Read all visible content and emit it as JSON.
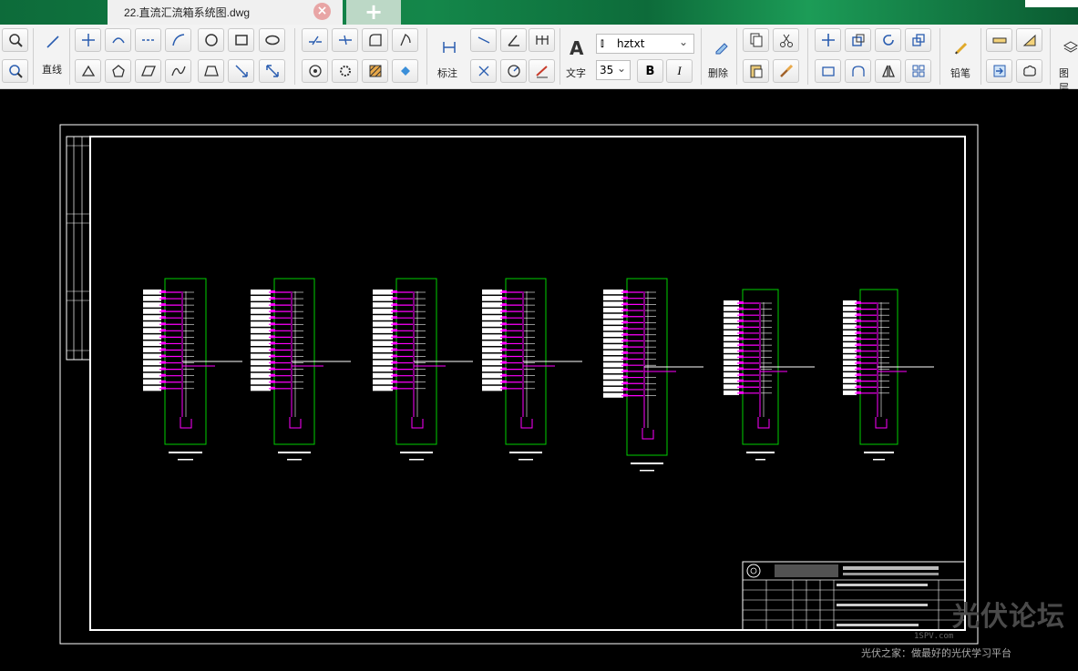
{
  "tab": {
    "title": "22.直流汇流箱系统图.dwg",
    "close": "×",
    "add": "+"
  },
  "toolbar": {
    "line_label": "直线",
    "dimension_label": "标注",
    "text_label": "文字",
    "text_icon": "A",
    "font_name": "hztxt",
    "font_size": "35",
    "bold": "B",
    "italic": "I",
    "delete_label": "删除",
    "pencil_label": "铅笔",
    "layer_label": "图层"
  },
  "watermark": {
    "brand": "光伏论坛",
    "tagline": "光伏之家：做最好的光伏学习平台",
    "url": "1SPV.com"
  },
  "colors": {
    "accent_green": "#14874a",
    "cad_green": "#00d000",
    "cad_magenta": "#ff00ff"
  }
}
